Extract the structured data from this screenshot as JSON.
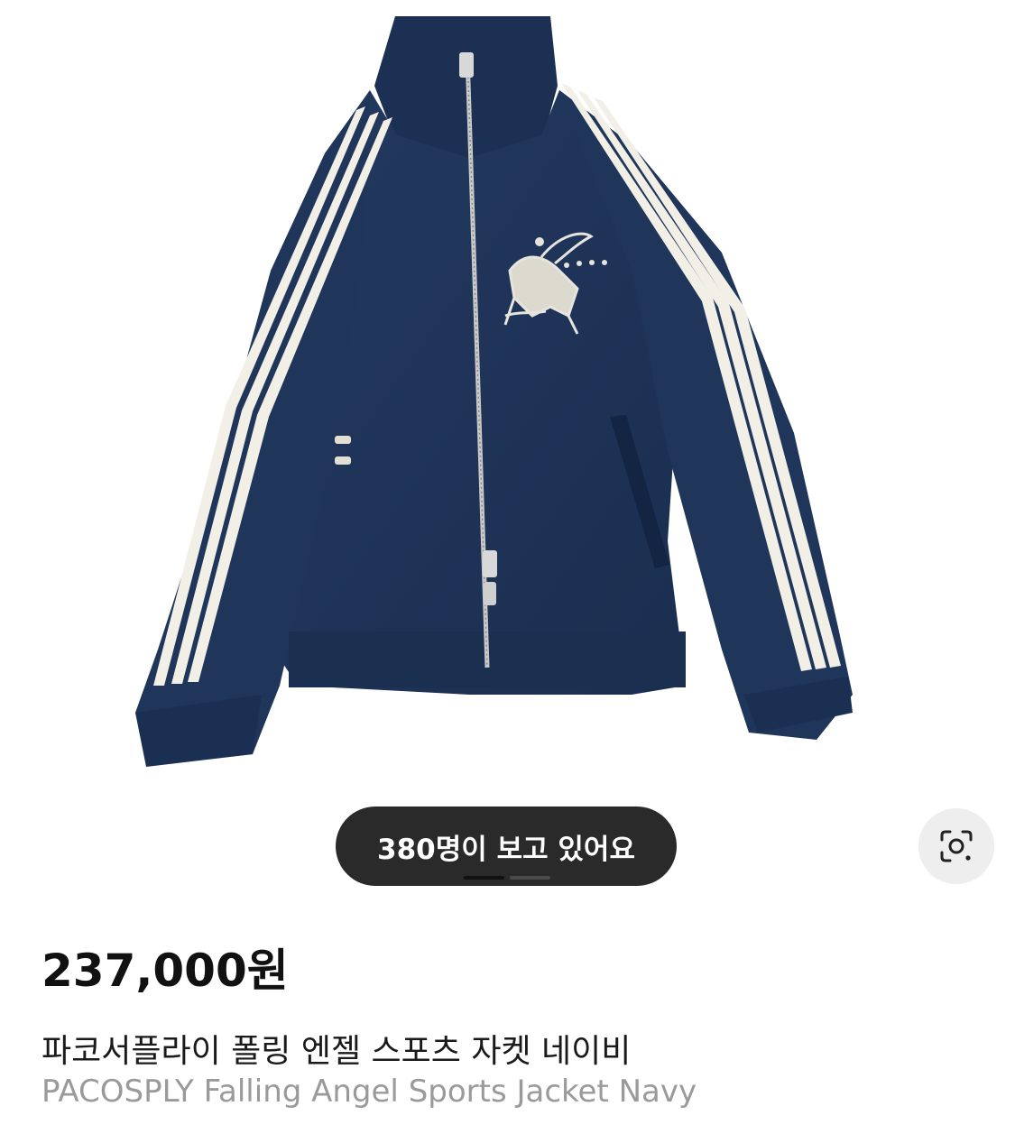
{
  "product": {
    "image_alt": "navy track jacket with white sleeve stripes and embroidered winged horse",
    "viewers_text": "380명이 보고 있어요",
    "price": "237,000원",
    "title_ko": "파코서플라이 폴링 엔젤 스포츠 자켓 네이비",
    "title_en": "PACOSPLY Falling Angel Sports Jacket Navy"
  },
  "pager": {
    "total": 2,
    "active_index": 0
  },
  "icons": {
    "lens": "image-search-icon"
  },
  "colors": {
    "jacket": "#1e3356",
    "stripe": "#f1efe6",
    "pill_bg": "#2a2a2a",
    "lens_bg": "#eeeeee"
  }
}
